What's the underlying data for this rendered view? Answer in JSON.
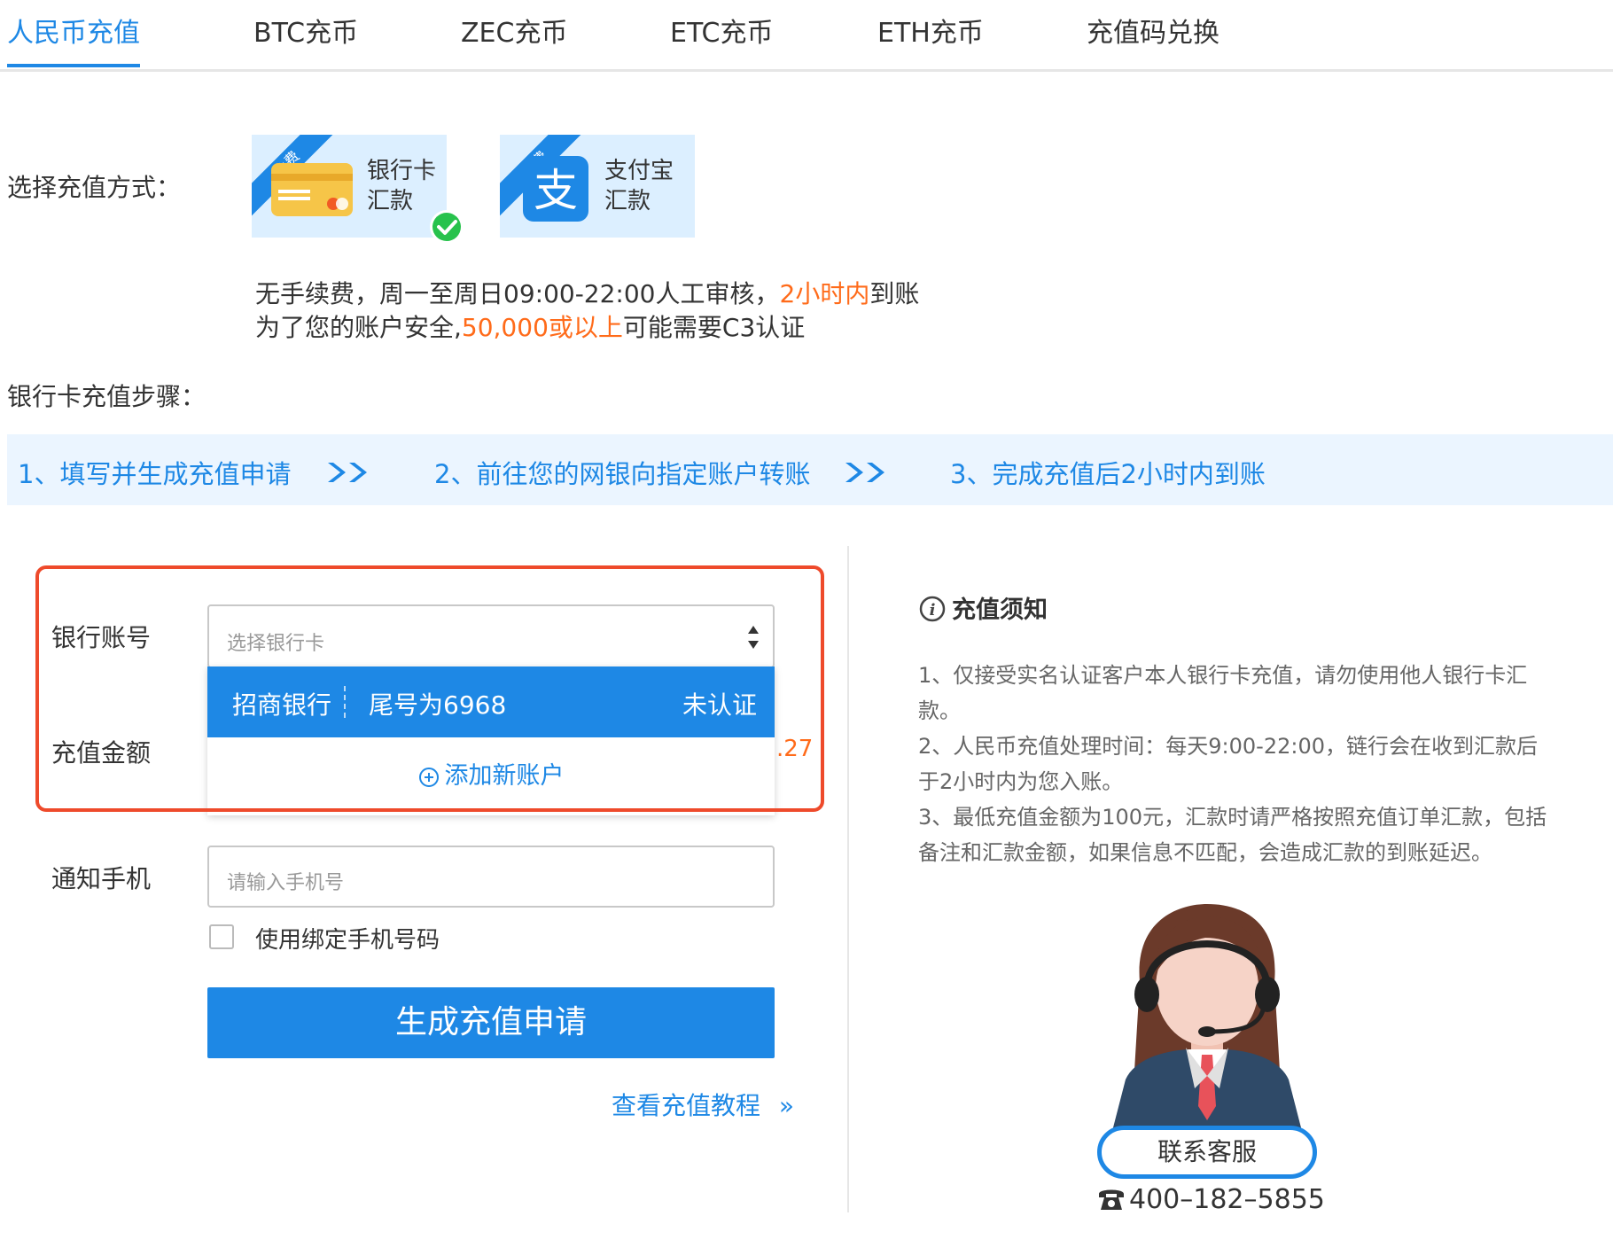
{
  "tabs": [
    {
      "label": "人民币充值",
      "active": true
    },
    {
      "label": "BTC充币"
    },
    {
      "label": "ZEC充币"
    },
    {
      "label": "ETC充币"
    },
    {
      "label": "ETH充币"
    },
    {
      "label": "充值码兑换"
    }
  ],
  "method": {
    "label": "选择充值方式：",
    "options": [
      {
        "ribbon": "免费",
        "line1": "银行卡",
        "line2": "汇款",
        "selected": true
      },
      {
        "ribbon": "免费",
        "line1": "支付宝",
        "line2": "汇款",
        "selected": false
      }
    ],
    "info1_a": "无手续费，周一至周日09:00-22:00人工审核，",
    "info1_b": "2小时内",
    "info1_c": "到账",
    "info2_a": "为了您的账户安全,",
    "info2_b": "50,000或以上",
    "info2_c": "可能需要C3认证"
  },
  "steps": {
    "title": "银行卡充值步骤：",
    "items": [
      "1、填写并生成充值申请",
      "2、前往您的网银向指定账户转账",
      "3、完成充值后2小时内到账"
    ],
    "arrow": "》"
  },
  "form": {
    "bank_account_label": "银行账号",
    "bank_select_placeholder": "选择银行卡",
    "dropdown": {
      "bank_name": "招商银行",
      "card_tail": "尾号为6968",
      "status": "未认证",
      "add_new": "添加新账户"
    },
    "amount_label": "充值金额",
    "amount_partial": ".27",
    "phone_label": "通知手机",
    "phone_placeholder": "请输入手机号",
    "use_bound_phone": "使用绑定手机号码",
    "submit_label": "生成充值申请",
    "tutorial_link": "查看充值教程",
    "tutorial_arrow": "»"
  },
  "notice": {
    "title": "充值须知",
    "items": [
      "1、仅接受实名认证客户本人银行卡充值，请勿使用他人银行卡汇款。",
      "2、人民币充值处理时间：每天9:00-22:00，链行会在收到汇款后于2小时内为您入账。",
      "3、最低充值金额为100元，汇款时请严格按照充值订单汇款，包括备注和汇款金额，如果信息不匹配，会造成汇款的到账延迟。"
    ]
  },
  "service": {
    "button_label": "联系客服",
    "phone": "400–182–5855"
  },
  "colors": {
    "accent": "#1e88e5",
    "highlight": "#ff6b1a",
    "annotation": "#ee4a2b"
  }
}
